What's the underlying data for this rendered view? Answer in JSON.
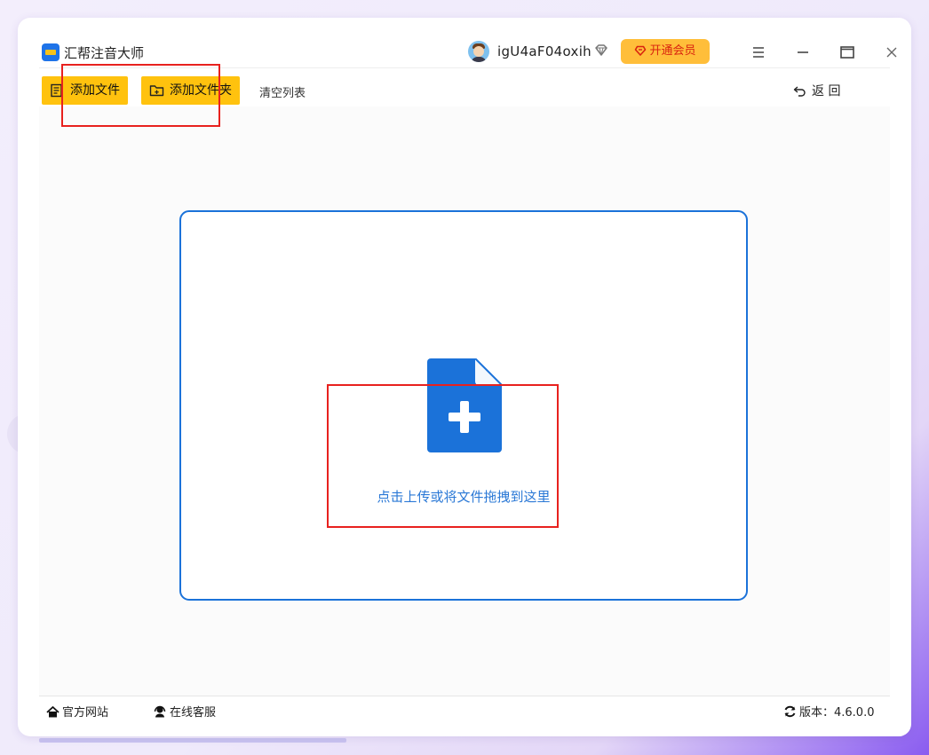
{
  "app": {
    "title": "汇帮注音大师",
    "logo_icon": "app-logo-icon"
  },
  "user": {
    "name": "igU4aF04oxih",
    "avatar_icon": "avatar-icon",
    "badge_icon": "diamond-icon"
  },
  "vip": {
    "label": "开通会员",
    "color": "#ffbe3a",
    "text_color": "#d9230f"
  },
  "window_controls": {
    "menu_icon": "hamburger-menu-icon",
    "minimize_icon": "minimize-icon",
    "maximize_icon": "maximize-icon",
    "close_icon": "close-icon"
  },
  "toolbar": {
    "add_file_label": "添加文件",
    "add_folder_label": "添加文件夹",
    "clear_list_label": "清空列表",
    "back_label": "返 回",
    "button_color": "#ffc20e"
  },
  "dropzone": {
    "hint": "点击上传或将文件拖拽到这里",
    "accent_color": "#1b72d9",
    "icon": "file-add-icon"
  },
  "statusbar": {
    "website_label": "官方网站",
    "support_label": "在线客服",
    "version_label": "版本：4.6.0.0"
  },
  "annotation_color": "#e8211e"
}
